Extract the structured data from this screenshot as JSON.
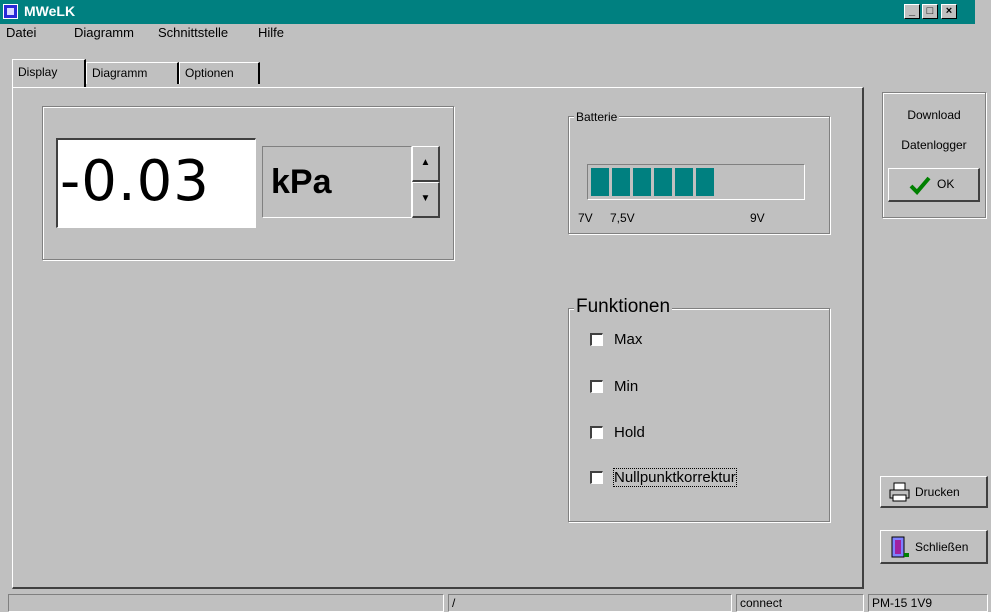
{
  "window": {
    "title": "MWeLK",
    "minimize": "_",
    "maximize": "□",
    "close": "×"
  },
  "menu": {
    "items": [
      "Datei",
      "Diagramm",
      "Schnittstelle",
      "Hilfe"
    ]
  },
  "tabs": [
    "Display",
    "Diagramm",
    "Optionen"
  ],
  "active_tab": "Display",
  "display": {
    "value": "-0.03",
    "unit": "kPa",
    "spin_up": "▲",
    "spin_down": "▼"
  },
  "battery": {
    "label": "Batterie",
    "level_segments": 6,
    "total_segments": 11,
    "ticks": [
      "7V",
      "7,5V",
      "9V"
    ]
  },
  "functions": {
    "legend": "Funktionen",
    "options": [
      {
        "label": "Max",
        "checked": false
      },
      {
        "label": "Min",
        "checked": false
      },
      {
        "label": "Hold",
        "checked": false
      },
      {
        "label": "Nullpunktkorrektur",
        "checked": false
      }
    ]
  },
  "download": {
    "line1": "Download",
    "line2": "Datenlogger",
    "ok_label": "OK",
    "ok_icon": "checkmark-icon"
  },
  "buttons": {
    "print_label": "Drucken",
    "print_icon": "printer-icon",
    "close_label": "Schließen",
    "close_icon": "exit-icon"
  },
  "status": {
    "cell1": "",
    "cell2": "/",
    "cell3": "connect",
    "cell4": "PM-15  1V9"
  },
  "colors": {
    "titlebar": "#008080",
    "battery_fill": "#008080",
    "face": "#c0c0c0"
  }
}
